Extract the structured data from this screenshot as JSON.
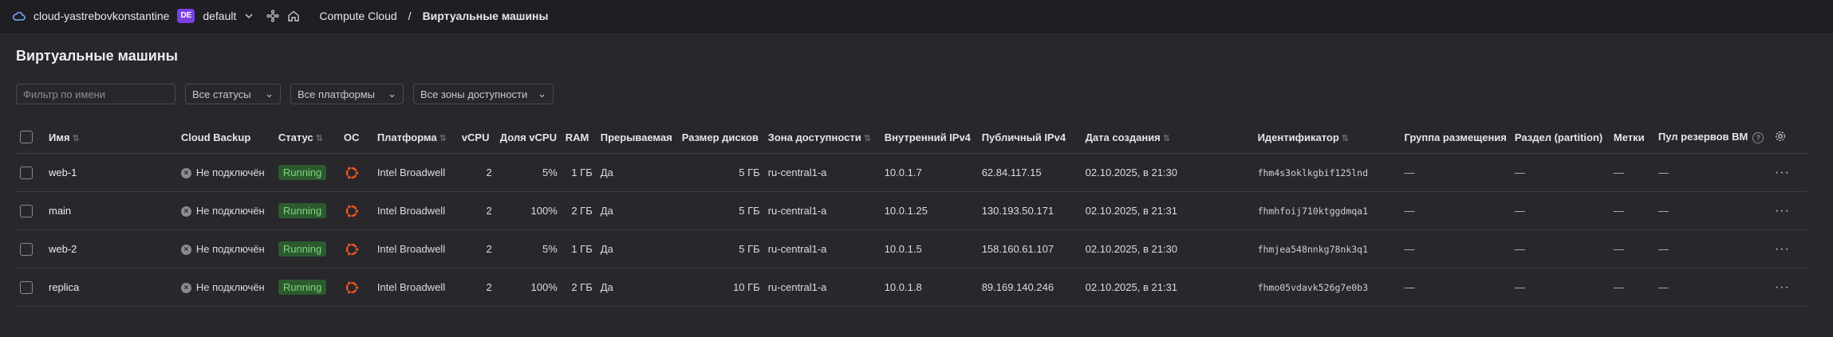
{
  "topbar": {
    "cloud_name": "cloud-yastrebovkonstantine",
    "folder_badge": "DE",
    "folder_name": "default",
    "breadcrumb_service": "Compute Cloud",
    "breadcrumb_separator": "/",
    "breadcrumb_current": "Виртуальные машины"
  },
  "page": {
    "title": "Виртуальные машины"
  },
  "filters": {
    "name_placeholder": "Фильтр по имени",
    "status": "Все статусы",
    "platform": "Все платформы",
    "zone": "Все зоны доступности"
  },
  "table": {
    "headers": {
      "name": "Имя",
      "backup": "Cloud Backup",
      "status": "Статус",
      "os": "ОС",
      "platform": "Платформа",
      "vcpu": "vCPU",
      "vcpu_share": "Доля vCPU",
      "ram": "RAM",
      "preemptible": "Прерываемая",
      "disk_size": "Размер дисков",
      "zone": "Зона доступности",
      "internal_ip": "Внутренний IPv4",
      "public_ip": "Публичный IPv4",
      "created": "Дата создания",
      "id": "Идентификатор",
      "placement_group": "Группа размещения",
      "partition": "Раздел (partition)",
      "labels": "Метки",
      "reserve_pool": "Пул резервов ВМ"
    },
    "rows": [
      {
        "name": "web-1",
        "backup": "Не подключён",
        "status": "Running",
        "os_icon": "ubuntu-icon",
        "platform": "Intel Broadwell",
        "vcpu": "2",
        "vcpu_share": "5%",
        "ram": "1 ГБ",
        "preemptible": "Да",
        "disk_size": "5 ГБ",
        "zone": "ru-central1-a",
        "internal_ip": "10.0.1.7",
        "public_ip": "62.84.117.15",
        "created": "02.10.2025, в 21:30",
        "id": "fhm4s3oklkgbif125lnd",
        "placement_group": "—",
        "partition": "—",
        "labels": "—",
        "reserve_pool": "—"
      },
      {
        "name": "main",
        "backup": "Не подключён",
        "status": "Running",
        "os_icon": "ubuntu-icon",
        "platform": "Intel Broadwell",
        "vcpu": "2",
        "vcpu_share": "100%",
        "ram": "2 ГБ",
        "preemptible": "Да",
        "disk_size": "5 ГБ",
        "zone": "ru-central1-a",
        "internal_ip": "10.0.1.25",
        "public_ip": "130.193.50.171",
        "created": "02.10.2025, в 21:31",
        "id": "fhmhfoij710ktggdmqa1",
        "placement_group": "—",
        "partition": "—",
        "labels": "—",
        "reserve_pool": "—"
      },
      {
        "name": "web-2",
        "backup": "Не подключён",
        "status": "Running",
        "os_icon": "ubuntu-icon",
        "platform": "Intel Broadwell",
        "vcpu": "2",
        "vcpu_share": "5%",
        "ram": "1 ГБ",
        "preemptible": "Да",
        "disk_size": "5 ГБ",
        "zone": "ru-central1-a",
        "internal_ip": "10.0.1.5",
        "public_ip": "158.160.61.107",
        "created": "02.10.2025, в 21:30",
        "id": "fhmjea548nnkg78nk3q1",
        "placement_group": "—",
        "partition": "—",
        "labels": "—",
        "reserve_pool": "—"
      },
      {
        "name": "replica",
        "backup": "Не подключён",
        "status": "Running",
        "os_icon": "ubuntu-icon",
        "platform": "Intel Broadwell",
        "vcpu": "2",
        "vcpu_share": "100%",
        "ram": "2 ГБ",
        "preemptible": "Да",
        "disk_size": "10 ГБ",
        "zone": "ru-central1-a",
        "internal_ip": "10.0.1.8",
        "public_ip": "89.169.140.246",
        "created": "02.10.2025, в 21:31",
        "id": "fhmo05vdavk526g7e0b3",
        "placement_group": "—",
        "partition": "—",
        "labels": "—",
        "reserve_pool": "—"
      }
    ]
  },
  "colors": {
    "background": "#27272c",
    "status_running_bg": "#2b5a2e",
    "status_running_text": "#7fd47f",
    "ubuntu": "#e95420",
    "badge": "#7b3fe4"
  }
}
